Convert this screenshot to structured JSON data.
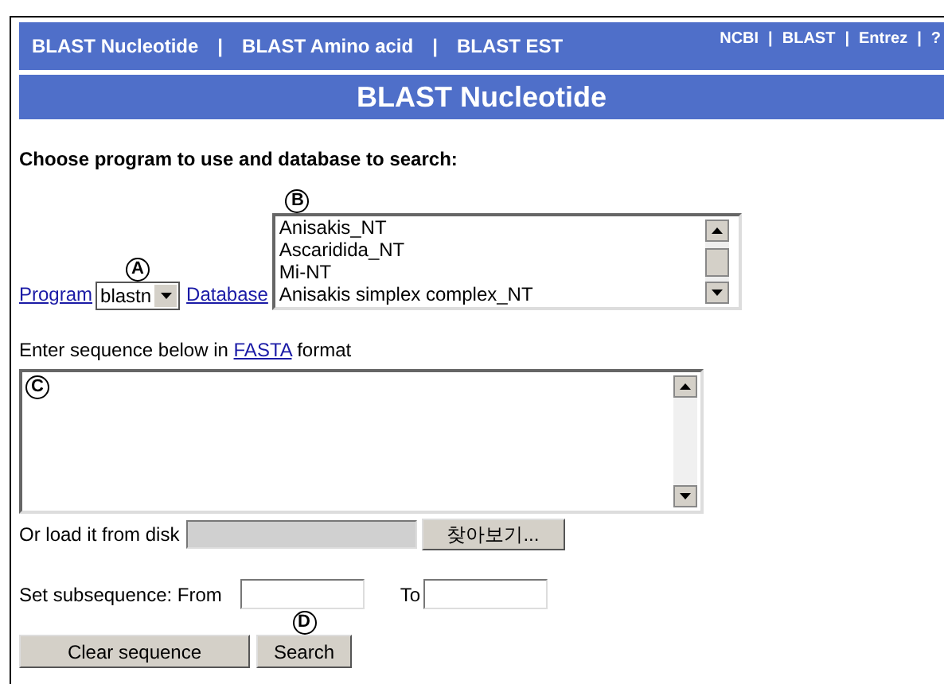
{
  "top_nav": {
    "links": [
      "BLAST Nucleotide",
      "BLAST Amino acid",
      "BLAST EST"
    ],
    "separator": "|",
    "right_links": [
      "NCBI",
      "BLAST",
      "Entrez",
      "?"
    ]
  },
  "title": "BLAST Nucleotide",
  "heading": "Choose program to use and database to search:",
  "program": {
    "link": "Program",
    "value": "blastn",
    "marker": "A"
  },
  "database": {
    "link": "Database",
    "marker": "B",
    "options": [
      "Anisakis_NT",
      "Ascaridida_NT",
      "Mi-NT",
      "Anisakis simplex complex_NT"
    ]
  },
  "sequence": {
    "label_before": "Enter sequence below in",
    "link": "FASTA",
    "label_after": "format",
    "marker": "C"
  },
  "load": {
    "label": "Or load it from disk",
    "browse_button": "찾아보기..."
  },
  "subsequence": {
    "label": "Set subsequence: From",
    "to_label": "To"
  },
  "buttons": [
    {
      "label": "Clear sequence"
    },
    {
      "label": "Search",
      "marker": "D"
    }
  ]
}
